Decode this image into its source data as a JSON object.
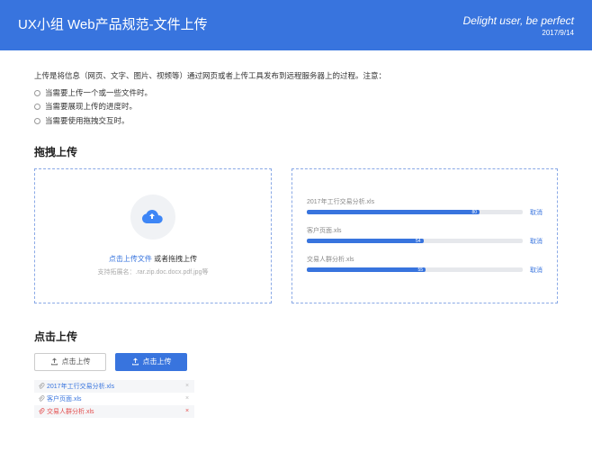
{
  "header": {
    "title": "UX小组 Web产品规范-文件上传",
    "slogan": "Delight user, be perfect",
    "date": "2017/9/14"
  },
  "intro": "上传是将信息（网页、文字、图片、视频等）通过网页或者上传工具发布到远程服务器上的过程。注意：",
  "bullets": [
    "当需要上传一个或一些文件时。",
    "当需要展现上传的进度时。",
    "当需要使用拖拽交互时。"
  ],
  "drag": {
    "title": "拖拽上传",
    "link_action": "点击上传文件",
    "link_rest": " 或者拖拽上传",
    "hint": "支持拓展名：.rar.zip.doc.docx.pdf.jpg等",
    "progress": [
      {
        "name": "2017年工行交易分析.xls",
        "pct": 80,
        "cancel": "取消"
      },
      {
        "name": "客户页面.xls",
        "pct": 54,
        "cancel": "取消"
      },
      {
        "name": "交易人群分析.xls",
        "pct": 55,
        "cancel": "取消"
      }
    ]
  },
  "click": {
    "title": "点击上传",
    "btn_outline": "点击上传",
    "btn_primary": "点击上传",
    "files": [
      {
        "name": "2017年工行交易分析.xls",
        "error": false
      },
      {
        "name": "客户页面.xls",
        "error": false
      },
      {
        "name": "交易人群分析.xls",
        "error": true
      }
    ]
  }
}
